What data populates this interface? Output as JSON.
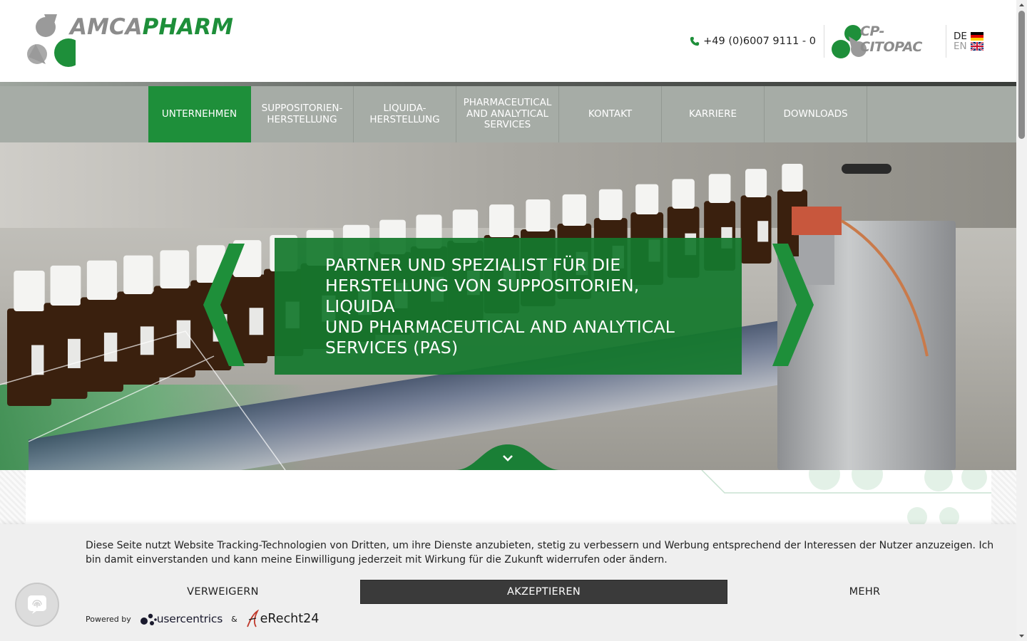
{
  "header": {
    "logo": {
      "text_gray": "AMCA",
      "text_green": "PHARM"
    },
    "phone": "+49 (0)6007 9111 - 0",
    "partner_logo": {
      "text": "CP-CITOPAC"
    },
    "languages": [
      {
        "code": "DE",
        "flag": "de-flag-icon"
      },
      {
        "code": "EN",
        "flag": "uk-flag-icon"
      }
    ]
  },
  "nav": {
    "items": [
      {
        "label": "UNTERNEHMEN",
        "active": true
      },
      {
        "label": "SUPPOSITORIEN-HERSTELLUNG",
        "active": false
      },
      {
        "label": "LIQUIDA-HERSTELLUNG",
        "active": false
      },
      {
        "label": "PHARMACEUTICAL AND ANALYTICAL SERVICES",
        "active": false
      },
      {
        "label": "KONTAKT",
        "active": false
      },
      {
        "label": "KARRIERE",
        "active": false
      },
      {
        "label": "DOWNLOADS",
        "active": false
      }
    ]
  },
  "hero": {
    "caption_lines": [
      "PARTNER UND SPEZIALIST FÜR DIE",
      "HERSTELLUNG VON SUPPOSITORIEN,",
      "LIQUIDA",
      "UND PHARMACEUTICAL AND ANALYTICAL",
      "SERVICES (PAS)"
    ]
  },
  "cookie": {
    "text": "Diese Seite nutzt Website Tracking-Technologien von Dritten, um ihre Dienste anzubieten, stetig zu verbessern und Werbung entsprechend der Interessen der Nutzer anzuzeigen. Ich bin damit einverstanden und kann meine Einwilligung jederzeit mit Wirkung für die Zukunft widerrufen oder ändern.",
    "reject_label": "VERWEIGERN",
    "accept_label": "AKZEPTIEREN",
    "more_label": "MEHR",
    "powered_by": "Powered by",
    "usercentrics": "usercentrics",
    "ampersand": "&",
    "erecht": "eRecht24"
  },
  "colors": {
    "brand_green": "#1e8f3a",
    "logo_gray": "#8c8c8c",
    "nav_gray": "#a6aca6",
    "accept_dark": "#3a3a3a"
  }
}
